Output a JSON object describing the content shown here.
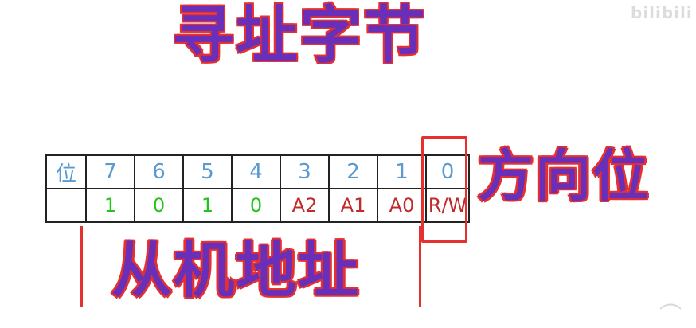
{
  "title": "寻址字节",
  "watermark": "bilibili",
  "direction_label": "方向位",
  "address_label": "从机地址",
  "table": {
    "header": [
      "位",
      "7",
      "6",
      "5",
      "4",
      "3",
      "2",
      "1",
      "0"
    ],
    "row": [
      "",
      "1",
      "0",
      "1",
      "0",
      "A2",
      "A1",
      "A0",
      "R/W"
    ]
  },
  "colors": {
    "title_fill": "#6a2fb8",
    "title_outline": "#e53030",
    "header_digits": "#5b9ad0",
    "fixed_bits": "#22c41c",
    "variable_bits": "#c02a2a",
    "annotation_lines": "#e53030"
  }
}
